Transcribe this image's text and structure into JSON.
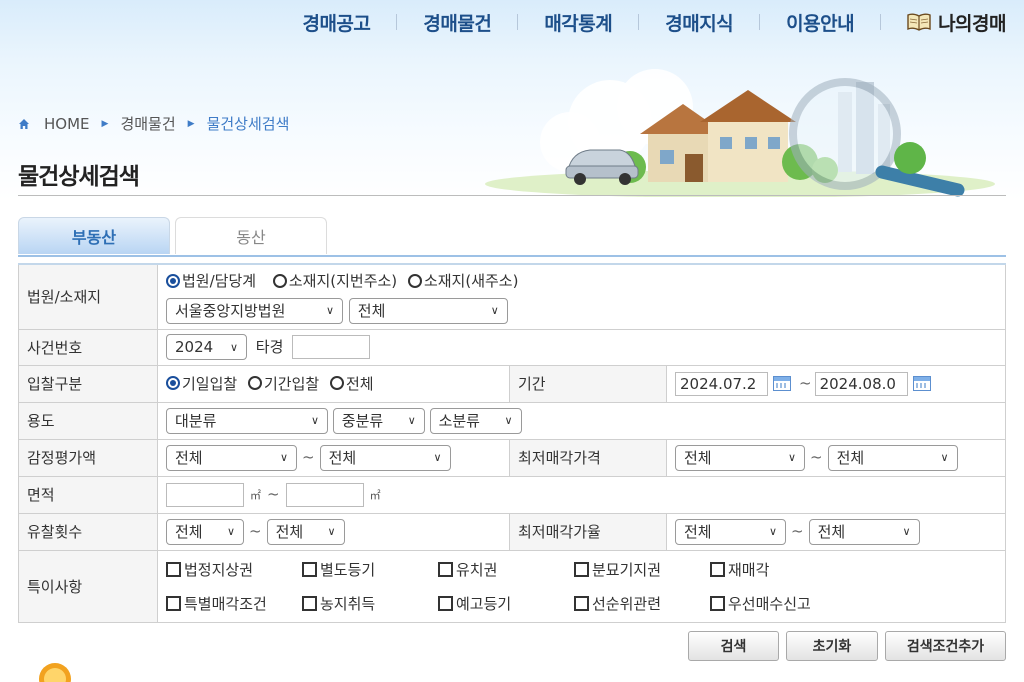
{
  "gnb": {
    "items": [
      "경매공고",
      "경매물건",
      "매각통계",
      "경매지식",
      "이용안내"
    ],
    "mine": "나의경매",
    "mine_icon": "book-icon"
  },
  "breadcrumb": {
    "home": "HOME",
    "level1": "경매물건",
    "current": "물건상세검색"
  },
  "page_title": "물건상세검색",
  "tabs": {
    "active": "부동산",
    "other": "동산"
  },
  "form": {
    "court": {
      "label": "법원/소재지",
      "radios": [
        "법원/담당계",
        "소재지(지번주소)",
        "소재지(새주소)"
      ],
      "selected_radio": "법원/담당계",
      "court_select": "서울중앙지방법원",
      "dept_select": "전체"
    },
    "case": {
      "label": "사건번호",
      "year": "2024",
      "type_label": "타경",
      "number": ""
    },
    "bid": {
      "label": "입찰구분",
      "radios": [
        "기일입찰",
        "기간입찰",
        "전체"
      ],
      "selected_radio": "기일입찰",
      "period_label": "기간",
      "date_from": "2024.07.2",
      "date_to": "2024.08.0",
      "calendar_icon": "calendar-icon"
    },
    "usage": {
      "label": "용도",
      "large": "대분류",
      "medium": "중분류",
      "small": "소분류"
    },
    "appraisal": {
      "label": "감정평가액",
      "from": "전체",
      "to": "전체",
      "min_price_label": "최저매각가격",
      "min_from": "전체",
      "min_to": "전체"
    },
    "area": {
      "label": "면적",
      "from": "",
      "to": "",
      "unit": "㎡"
    },
    "fail": {
      "label": "유찰횟수",
      "from": "전체",
      "to": "전체",
      "rate_label": "최저매각가율",
      "rate_from": "전체",
      "rate_to": "전체"
    },
    "special": {
      "label": "특이사항",
      "row1": [
        "법정지상권",
        "별도등기",
        "유치권",
        "분묘기지권",
        "재매각"
      ],
      "row2": [
        "특별매각조건",
        "농지취득",
        "예고등기",
        "선순위관련",
        "우선매수신고"
      ]
    },
    "tilde": "~"
  },
  "buttons": {
    "search": "검색",
    "reset": "초기화",
    "add": "검색조건추가"
  },
  "colors": {
    "primary": "#1d4f8a",
    "accent": "#3f7cc7"
  }
}
